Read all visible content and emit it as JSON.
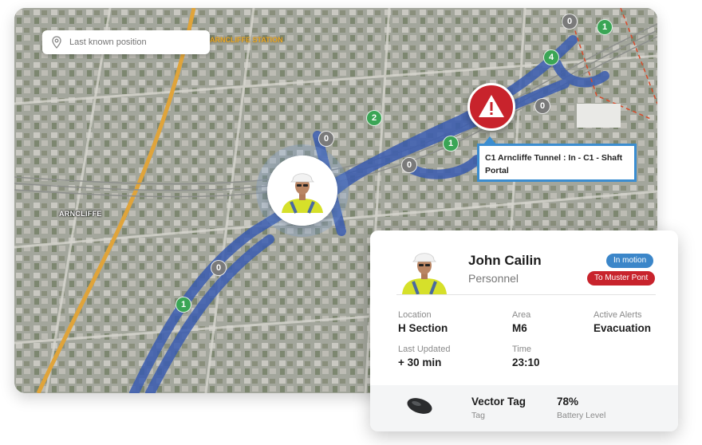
{
  "search": {
    "placeholder": "Last known position",
    "icon": "location-pin-icon"
  },
  "map": {
    "station_label": "ARNCLIFFE STATION",
    "suburb_label": "ARNCLIFFE",
    "nodes": [
      {
        "value": "0",
        "status": "grey"
      },
      {
        "value": "1",
        "status": "green"
      },
      {
        "value": "4",
        "status": "green"
      },
      {
        "value": "0",
        "status": "grey"
      },
      {
        "value": "2",
        "status": "green"
      },
      {
        "value": "0",
        "status": "grey"
      },
      {
        "value": "1",
        "status": "green"
      },
      {
        "value": "0",
        "status": "grey"
      },
      {
        "value": "0",
        "status": "grey"
      },
      {
        "value": "1",
        "status": "green"
      }
    ],
    "alert": {
      "icon": "warning-icon",
      "color": "#c8232c",
      "tooltip": "C1 Arncliffe Tunnel : In - C1 - Shaft Portal"
    }
  },
  "person": {
    "name": "John Cailin",
    "role": "Personnel",
    "badges": {
      "status": "In motion",
      "action": "To Muster Pont"
    },
    "fields": {
      "location_label": "Location",
      "location": "H Section",
      "area_label": "Area",
      "area": "M6",
      "alerts_label": "Active Alerts",
      "alerts": "Evacuation",
      "updated_label": "Last Updated",
      "updated": "+ 30 min",
      "time_label": "Time",
      "time": "23:10"
    },
    "device": {
      "name": "Vector Tag",
      "type": "Tag",
      "battery": "78%",
      "battery_label": "Battery Level"
    }
  },
  "colors": {
    "route": "#3a5cb0",
    "accent_blue": "#3b86c9",
    "alert_red": "#c8232c",
    "node_green": "#3aa555"
  }
}
